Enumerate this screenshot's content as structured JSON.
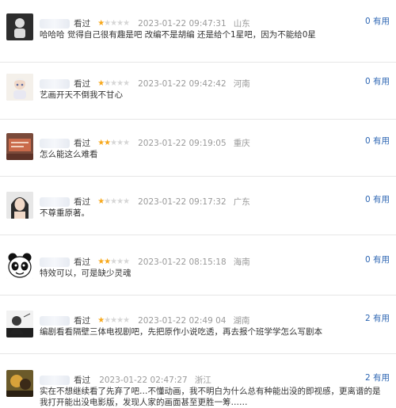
{
  "reviews": [
    {
      "user": "",
      "action": "看过",
      "rating": 1,
      "time": "2023-01-22 09:47:31",
      "location": "山东",
      "useful_count": "0",
      "useful_label": "有用",
      "comment": "哈哈哈 觉得自己很有趣是吧 改编不是胡编 还是给个1星吧，因为不能给0星"
    },
    {
      "user": "",
      "action": "看过",
      "rating": 1,
      "time": "2023-01-22 09:42:42",
      "location": "河南",
      "useful_count": "0",
      "useful_label": "有用",
      "comment": "艺画开天不倒我不甘心"
    },
    {
      "user": "",
      "action": "看过",
      "rating": 2,
      "time": "2023-01-22 09:19:05",
      "location": "重庆",
      "useful_count": "0",
      "useful_label": "有用",
      "comment": "怎么能这么难看"
    },
    {
      "user": "",
      "action": "看过",
      "rating": 1,
      "time": "2023-01-22 09:17:32",
      "location": "广东",
      "useful_count": "0",
      "useful_label": "有用",
      "comment": "不尊重原著。"
    },
    {
      "user": "",
      "action": "看过",
      "rating": 2,
      "time": "2023-01-22 08:15:18",
      "location": "海南",
      "useful_count": "0",
      "useful_label": "有用",
      "comment": "特效可以，可是缺少灵魂"
    },
    {
      "user": "",
      "action": "看过",
      "rating": 1,
      "time": "2023-01-22 02:49 04",
      "location": "湖南",
      "useful_count": "2",
      "useful_label": "有用",
      "comment": "编剧看看隔壁三体电视剧吧，先把原作小说吃透，再去报个班学学怎么写剧本"
    },
    {
      "user": "",
      "action": "看过",
      "rating": null,
      "time": "2023-01-22 02:47:27",
      "location": "浙江",
      "useful_count": "2",
      "useful_label": "有用",
      "comment": "实在不想继续看了先弃了吧…不懂动画，我不明白为什么总有种能出没的即视感，更离谱的是我打开能出没电影版，发现人家的画面甚至更胜一筹……"
    }
  ],
  "icons": {
    "star": "star-icon",
    "avatar": "avatar-icon"
  },
  "colors": {
    "star_on": "#f7a81b",
    "star_off": "#d6d6d6",
    "link": "#2d66b3",
    "meta": "#9a9a9a",
    "divider": "#e6e6e6"
  }
}
